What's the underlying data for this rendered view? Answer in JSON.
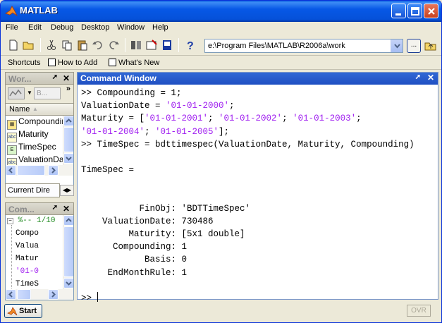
{
  "window": {
    "title": "MATLAB"
  },
  "menu": {
    "items": [
      "File",
      "Edit",
      "Debug",
      "Desktop",
      "Window",
      "Help"
    ]
  },
  "toolbar": {
    "current_directory": "e:\\Program Files\\MATLAB\\R2006a\\work",
    "browse_label": "..."
  },
  "shortcuts": {
    "label": "Shortcuts",
    "items": [
      "How to Add",
      "What's New"
    ]
  },
  "workspace": {
    "title": "Wor...",
    "stack_label": "B...",
    "column_name": "Name",
    "variables": [
      {
        "name": "Compounding",
        "icon": "matrix-icon"
      },
      {
        "name": "Maturity",
        "icon": "string-icon"
      },
      {
        "name": "TimeSpec",
        "icon": "struct-icon"
      },
      {
        "name": "ValuationDate",
        "icon": "string-icon"
      }
    ]
  },
  "current_directory_tab": {
    "label": "Current Dire"
  },
  "command_history": {
    "title": "Com...",
    "header": "%-- 1/10",
    "items": [
      "Compo",
      "Valua",
      "Matur",
      "'01-0",
      "TimeS"
    ]
  },
  "command_window": {
    "title": "Command Window",
    "lines": [
      [
        {
          "t": ">> Compounding = 1;"
        }
      ],
      [
        {
          "t": "ValuationDate = "
        },
        {
          "t": "'01-01-2000'",
          "s": 1
        },
        {
          "t": ";"
        }
      ],
      [
        {
          "t": "Maturity = ["
        },
        {
          "t": "'01-01-2001'",
          "s": 1
        },
        {
          "t": "; "
        },
        {
          "t": "'01-01-2002'",
          "s": 1
        },
        {
          "t": "; "
        },
        {
          "t": "'01-01-2003'",
          "s": 1
        },
        {
          "t": ";"
        }
      ],
      [
        {
          "t": "'01-01-2004'",
          "s": 1
        },
        {
          "t": "; "
        },
        {
          "t": "'01-01-2005'",
          "s": 1
        },
        {
          "t": "];"
        }
      ],
      [
        {
          "t": ">> TimeSpec = bdttimespec(ValuationDate, Maturity, Compounding)"
        }
      ],
      [
        {
          "t": ""
        }
      ],
      [
        {
          "t": "TimeSpec ="
        }
      ],
      [
        {
          "t": ""
        }
      ],
      [
        {
          "t": ""
        }
      ],
      [
        {
          "t": "           FinObj: 'BDTTimeSpec'"
        }
      ],
      [
        {
          "t": "    ValuationDate: 730486"
        }
      ],
      [
        {
          "t": "         Maturity: [5x1 double]"
        }
      ],
      [
        {
          "t": "      Compounding: 1"
        }
      ],
      [
        {
          "t": "            Basis: 0"
        }
      ],
      [
        {
          "t": "     EndMonthRule: 1"
        }
      ],
      [
        {
          "t": ""
        }
      ]
    ],
    "prompt": ">> "
  },
  "status": {
    "start_label": "Start",
    "ovr_label": "OVR"
  },
  "colors": {
    "titlebar": "#0758e6",
    "string": "#a020f0",
    "command_title": "#3168d5"
  }
}
